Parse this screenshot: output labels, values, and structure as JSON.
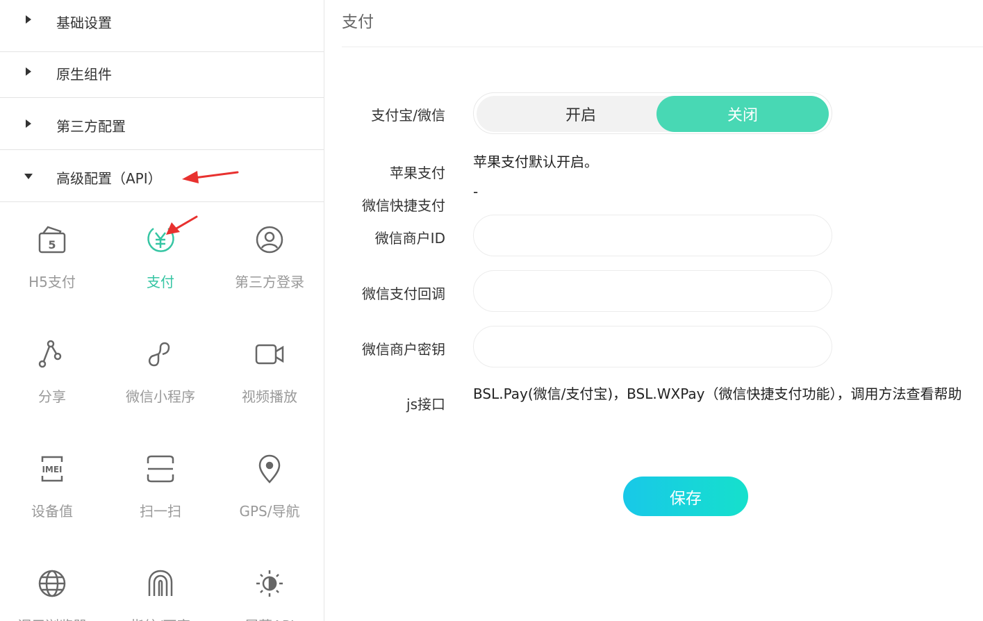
{
  "sidebar": {
    "sections": [
      {
        "label": "基础设置",
        "expanded": false
      },
      {
        "label": "原生组件",
        "expanded": false
      },
      {
        "label": "第三方配置",
        "expanded": false
      },
      {
        "label": "高级配置（API）",
        "expanded": true
      }
    ],
    "tiles": [
      {
        "label": "H5支付",
        "icon": "h5-pay-icon",
        "active": false
      },
      {
        "label": "支付",
        "icon": "yen-coin-icon",
        "active": true
      },
      {
        "label": "第三方登录",
        "icon": "user-circle-icon",
        "active": false
      },
      {
        "label": "分享",
        "icon": "share-icon",
        "active": false
      },
      {
        "label": "微信小程序",
        "icon": "mini-program-icon",
        "active": false
      },
      {
        "label": "视频播放",
        "icon": "video-camera-icon",
        "active": false
      },
      {
        "label": "设备值",
        "icon": "imei-icon",
        "active": false
      },
      {
        "label": "扫一扫",
        "icon": "scan-icon",
        "active": false
      },
      {
        "label": "GPS/导航",
        "icon": "location-pin-icon",
        "active": false
      },
      {
        "label": "调用浏览器",
        "icon": "globe-icon",
        "active": false
      },
      {
        "label": "指纹/面容",
        "icon": "fingerprint-icon",
        "active": false
      },
      {
        "label": "屏幕API",
        "icon": "brightness-icon",
        "active": false
      }
    ]
  },
  "main": {
    "title": "支付",
    "fields": {
      "alipay_wechat_label": "支付宝/微信",
      "toggle_on": "开启",
      "toggle_off": "关闭",
      "toggle_selected": "关闭",
      "apple_pay_label": "苹果支付",
      "apple_pay_text": "苹果支付默认开启。",
      "wechat_quick_label": "微信快捷支付",
      "wechat_quick_value": "-",
      "merchant_id_label": "微信商户ID",
      "merchant_id_value": "",
      "callback_label": "微信支付回调",
      "callback_value": "",
      "merchant_key_label": "微信商户密钥",
      "merchant_key_value": "",
      "js_label": "js接口",
      "js_text": "BSL.Pay(微信/支付宝)，BSL.WXPay（微信快捷支付功能），调用方法查看帮助"
    },
    "save_label": "保存"
  },
  "colors": {
    "accent": "#48d8b4",
    "active_tile": "#36c5a3",
    "annotation_arrow": "#e8312f",
    "save_gradient_start": "#18c8e8",
    "save_gradient_end": "#16e0cc"
  }
}
